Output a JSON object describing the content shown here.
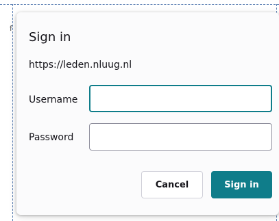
{
  "dialog": {
    "title": "Sign in",
    "origin": "https://leden.nluug.nl",
    "username_label": "Username",
    "username_value": "",
    "password_label": "Password",
    "password_value": "",
    "cancel_label": "Cancel",
    "signin_label": "Sign in"
  },
  "background": {
    "glyph": "f"
  },
  "colors": {
    "accent": "#0f7d8a",
    "text": "#15141a",
    "dialog_bg": "#fbfbfc"
  }
}
